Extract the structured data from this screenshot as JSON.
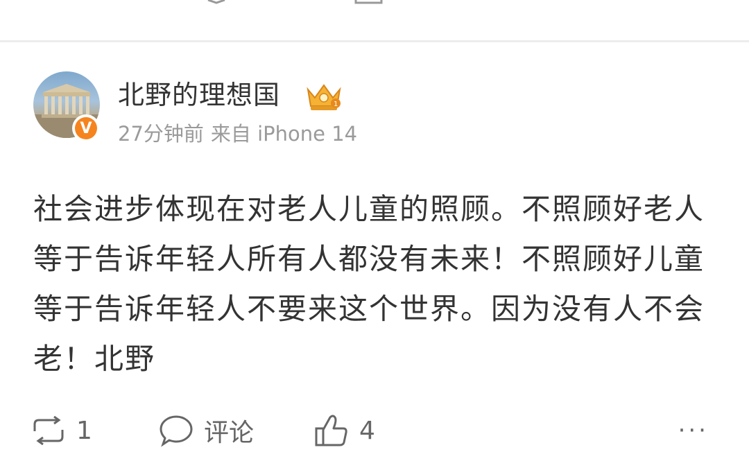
{
  "post": {
    "username": "北野的理想国",
    "time": "27分钟前",
    "source": "来自 iPhone 14",
    "content": "社会进步体现在对老人儿童的照顾。不照顾好老人等于告诉年轻人所有人都没有未来！不照顾好儿童等于告诉年轻人不要来这个世界。因为没有人不会老！北野"
  },
  "actions": {
    "repost_count": "1",
    "comment_label": "评论",
    "like_count": "4",
    "more_label": "···"
  },
  "icons": {
    "verified_badge": "V",
    "crown": "crown-icon",
    "repost": "repost-icon",
    "comment": "comment-icon",
    "like": "thumbs-up-icon",
    "more": "more-icon"
  },
  "colors": {
    "verified": "#f5841f",
    "crown": "#f0a020",
    "text": "#333333",
    "meta": "#9a9a9a"
  }
}
